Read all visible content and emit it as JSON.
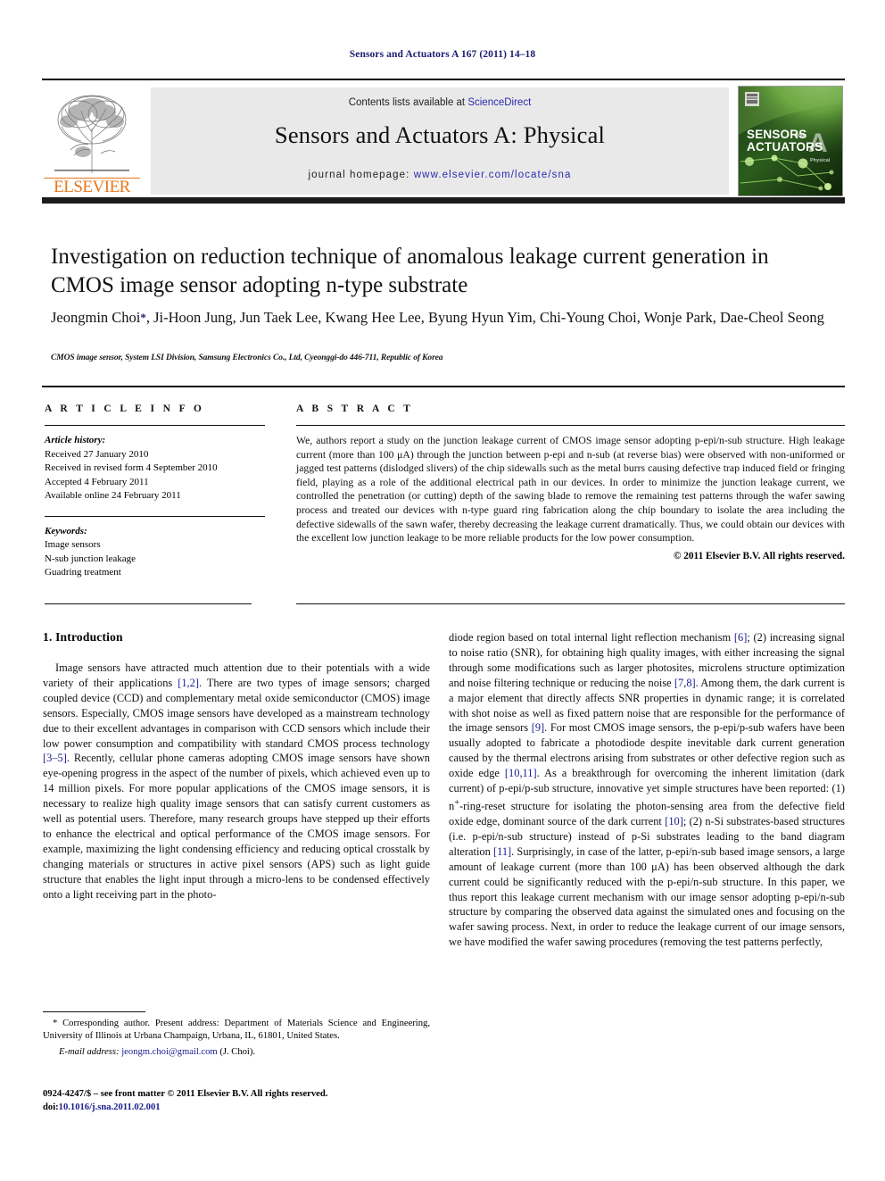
{
  "running_head": "Sensors and Actuators A 167 (2011) 14–18",
  "masthead": {
    "contents_prefix": "Contents lists available at ",
    "sciencedirect": "ScienceDirect",
    "journal_title": "Sensors and Actuators A: Physical",
    "homepage_prefix": "journal homepage:",
    "homepage_url": "www.elsevier.com/locate/sna",
    "publisher_wordmark": "ELSEVIER",
    "publisher_logo_icon": "elsevier-tree-icon",
    "cover_line1": "SENSORS",
    "cover_and": "and",
    "cover_line2": "ACTUATORS",
    "cover_letter": "A",
    "cover_sub": "Physical",
    "link_color": "#2a2ab0",
    "wordmark_color": "#e8761a"
  },
  "article": {
    "title": "Investigation on reduction technique of anomalous leakage current generation in CMOS image sensor adopting n-type substrate",
    "authors_part1": "Jeongmin Choi",
    "authors_star": "*",
    "authors_part2": ", Ji-Hoon Jung, Jun Taek Lee, Kwang Hee Lee, Byung Hyun Yim, Chi-Young Choi, Wonje Park, Dae-Cheol Seong",
    "affiliation": "CMOS image sensor, System LSI Division, Samsung Electronics Co., Ltd, Cyeonggi-do 446-711, Republic of Korea"
  },
  "article_info": {
    "label": "A R T I C L E   I N F O",
    "history_label": "Article history:",
    "history": [
      "Received 27 January 2010",
      "Received in revised form 4 September 2010",
      "Accepted 4 February 2011",
      "Available online 24 February 2011"
    ],
    "keywords_label": "Keywords:",
    "keywords": [
      "Image sensors",
      "N-sub junction leakage",
      "Guadring treatment"
    ]
  },
  "abstract": {
    "label": "A B S T R A C T",
    "text": "We, authors report a study on the junction leakage current of CMOS image sensor adopting p-epi/n-sub structure. High leakage current (more than 100 μA) through the junction between p-epi and n-sub (at reverse bias) were observed with non-uniformed or jagged test patterns (dislodged slivers) of the chip sidewalls such as the metal burrs causing defective trap induced field or fringing field, playing as a role of the additional electrical path in our devices. In order to minimize the junction leakage current, we controlled the penetration (or cutting) depth of the sawing blade to remove the remaining test patterns through the wafer sawing process and treated our devices with n-type guard ring fabrication along the chip boundary to isolate the area including the defective sidewalls of the sawn wafer, thereby decreasing the leakage current dramatically. Thus, we could obtain our devices with the excellent low junction leakage to be more reliable products for the low power consumption.",
    "copyright": "© 2011 Elsevier B.V. All rights reserved."
  },
  "body": {
    "section_heading": "1.  Introduction",
    "left_p1_a": "Image sensors have attracted much attention due to their potentials with a wide variety of their applications ",
    "left_ref_12": "[1,2]",
    "left_p1_b": ". There are two types of image sensors; charged coupled device (CCD) and complementary metal oxide semiconductor (CMOS) image sensors. Especially, CMOS image sensors have developed as a mainstream technology due to their excellent advantages in comparison with CCD sensors which include their low power consumption and compatibility with standard CMOS process technology ",
    "left_ref_35": "[3–5]",
    "left_p1_c": ". Recently, cellular phone cameras adopting CMOS image sensors have shown eye-opening progress in the aspect of the number of pixels, which achieved even up to 14 million pixels. For more popular applications of the CMOS image sensors, it is necessary to realize high quality image sensors that can satisfy current customers as well as potential users. Therefore, many research groups have stepped up their efforts to enhance the electrical and optical performance of the CMOS image sensors. For example, maximizing the light condensing efficiency and reducing optical crosstalk by changing materials or structures in active pixel sensors (APS) such as light guide structure that enables the light input through a micro-lens to be condensed effectively onto a light receiving part in the photo-",
    "right_a": "diode region based on total internal light reflection mechanism ",
    "right_ref_6": "[6]",
    "right_b": "; (2) increasing signal to noise ratio (SNR), for obtaining high quality images, with either increasing the signal through some modifications such as larger photosites, microlens structure optimization and noise filtering technique or reducing the noise ",
    "right_ref_78": "[7,8]",
    "right_c": ". Among them, the dark current is a major element that directly affects SNR properties in dynamic range; it is correlated with shot noise as well as fixed pattern noise that are responsible for the performance of the image sensors ",
    "right_ref_9": "[9]",
    "right_d": ". For most CMOS image sensors, the p-epi/p-sub wafers have been usually adopted to fabricate a photodiode despite inevitable dark current generation caused by the thermal electrons arising from substrates or other defective region such as oxide edge ",
    "right_ref_1011": "[10,11]",
    "right_e": ". As a breakthrough for overcoming the inherent limitation (dark current) of p-epi/p-sub structure, innovative yet simple structures have been reported: (1) n",
    "right_sup_plus": "+",
    "right_f": "-ring-reset structure for isolating the photon-sensing area from the defective field oxide edge, dominant source of the dark current ",
    "right_ref_10": "[10]",
    "right_g": "; (2) n-Si substrates-based structures (i.e. p-epi/n-sub structure) instead of p-Si substrates leading to the band diagram alteration ",
    "right_ref_11": "[11]",
    "right_h": ". Surprisingly, in case of the latter, p-epi/n-sub based image sensors, a large amount of leakage current (more than 100 μA) has been observed although the dark current could be significantly reduced with the p-epi/n-sub structure. In this paper, we thus report this leakage current mechanism with our image sensor adopting p-epi/n-sub structure by comparing the observed data against the simulated ones and focusing on the wafer sawing process. Next, in order to reduce the leakage current of our image sensors, we have modified the wafer sawing procedures (removing the test patterns perfectly,"
  },
  "footnotes": {
    "corresponding": "* Corresponding author. Present address: Department of Materials Science and Engineering, University of Illinois at Urbana Champaign, Urbana, IL, 61801, United States.",
    "email_label": "E-mail address:",
    "email": "jeongm.choi@gmail.com",
    "email_suffix": "(J. Choi).",
    "issn_line": "0924-4247/$ – see front matter © 2011 Elsevier B.V. All rights reserved.",
    "doi_prefix": "doi:",
    "doi": "10.1016/j.sna.2011.02.001"
  }
}
